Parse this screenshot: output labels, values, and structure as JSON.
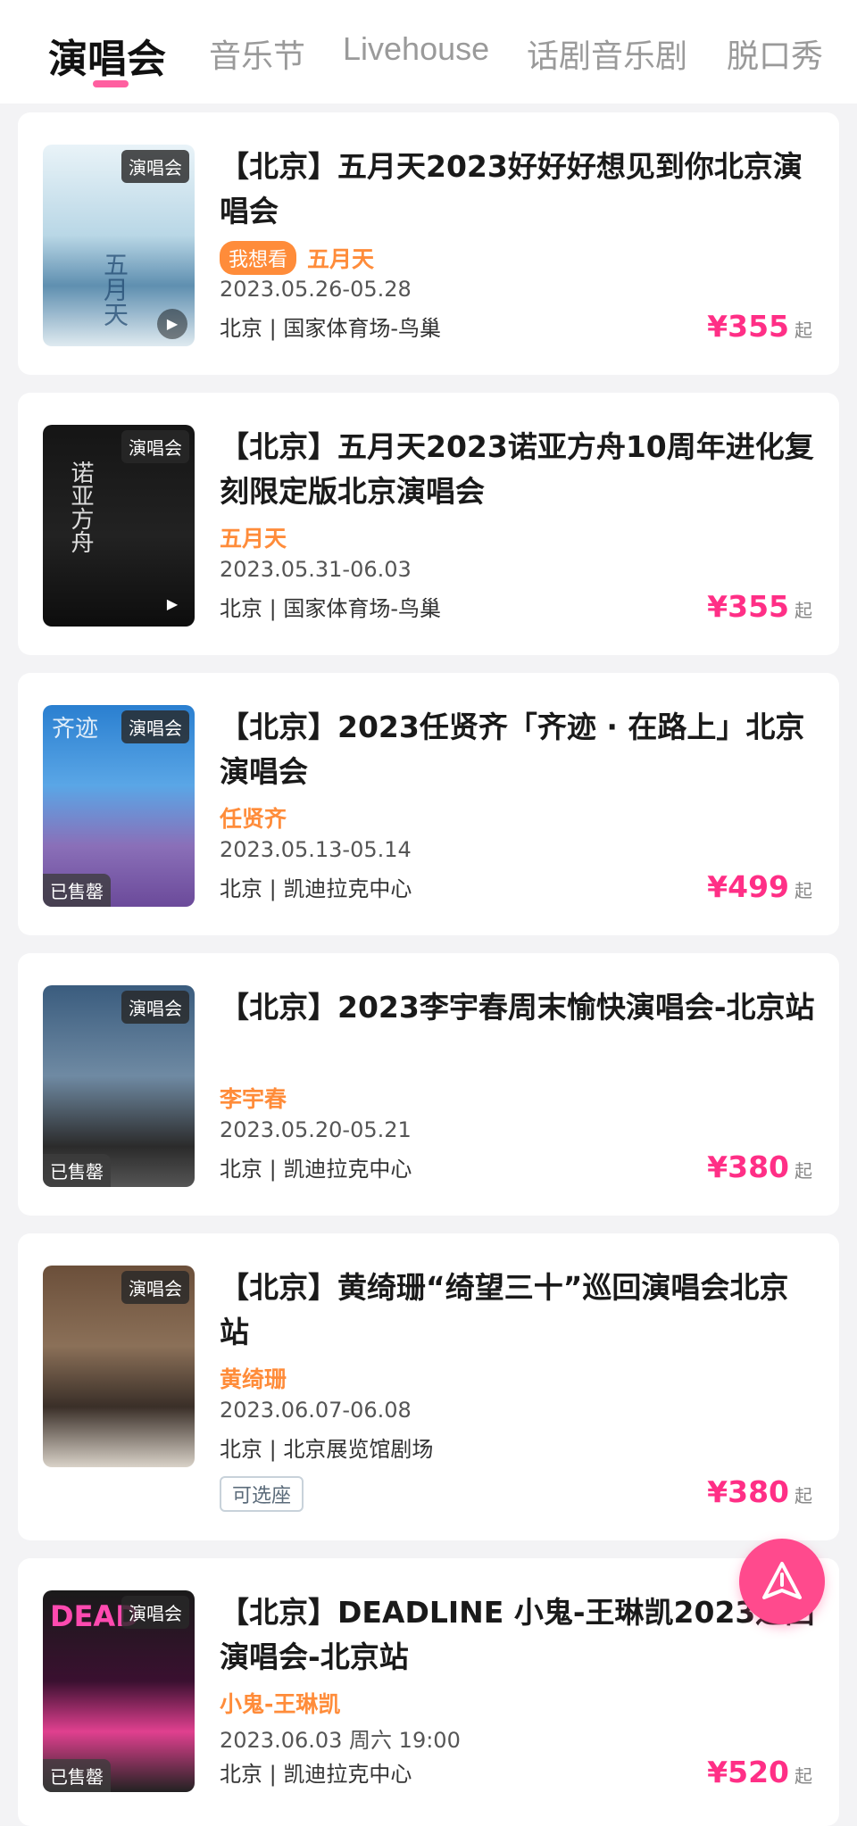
{
  "tabs": [
    "演唱会",
    "音乐节",
    "Livehouse",
    "话剧音乐剧",
    "脱口秀"
  ],
  "colors": {
    "accent": "#ff2f86",
    "artist": "#ff8c3a"
  },
  "events": [
    {
      "title": "【北京】五月天2023好好好想见到你北京演唱会",
      "tag": "演唱会",
      "want": "我想看",
      "artist": "五月天",
      "date": "2023.05.26-05.28",
      "venue": "北京 | 国家体育场-鸟巢",
      "price": "¥355",
      "price_suffix": "起"
    },
    {
      "title": "【北京】五月天2023诺亚方舟10周年进化复刻限定版北京演唱会",
      "tag": "演唱会",
      "artist": "五月天",
      "date": "2023.05.31-06.03",
      "venue": "北京 | 国家体育场-鸟巢",
      "price": "¥355",
      "price_suffix": "起"
    },
    {
      "title": "【北京】2023任贤齐「齐迹 · 在路上」北京演唱会",
      "tag": "演唱会",
      "sold": "已售罄",
      "artist": "任贤齐",
      "date": "2023.05.13-05.14",
      "venue": "北京 | 凯迪拉克中心",
      "price": "¥499",
      "price_suffix": "起"
    },
    {
      "title": "【北京】2023李宇春周末愉快演唱会-北京站",
      "tag": "演唱会",
      "sold": "已售罄",
      "artist": "李宇春",
      "date": "2023.05.20-05.21",
      "venue": "北京 | 凯迪拉克中心",
      "price": "¥380",
      "price_suffix": "起"
    },
    {
      "title": "【北京】黄绮珊“绮望三十”巡回演唱会北京站",
      "tag": "演唱会",
      "artist": "黄绮珊",
      "date": "2023.06.07-06.08",
      "venue": "北京 | 北京展览馆剧场",
      "seat": "可选座",
      "price": "¥380",
      "price_suffix": "起"
    },
    {
      "title": "【北京】DEADLINE 小鬼-王琳凯2023巡回演唱会-北京站",
      "tag": "演唱会",
      "sold": "已售罄",
      "artist": "小鬼-王琳凯",
      "date": "2023.06.03 周六 19:00",
      "venue": "北京 | 凯迪拉克中心",
      "price": "¥520",
      "price_suffix": "起"
    }
  ],
  "poster_texts": {
    "p1": "五月天",
    "p2": "诺亚方舟",
    "p3": "齐迹",
    "p6": "DEAD"
  },
  "icons": {
    "fab": "paper-plane-icon",
    "play": "play-icon"
  }
}
